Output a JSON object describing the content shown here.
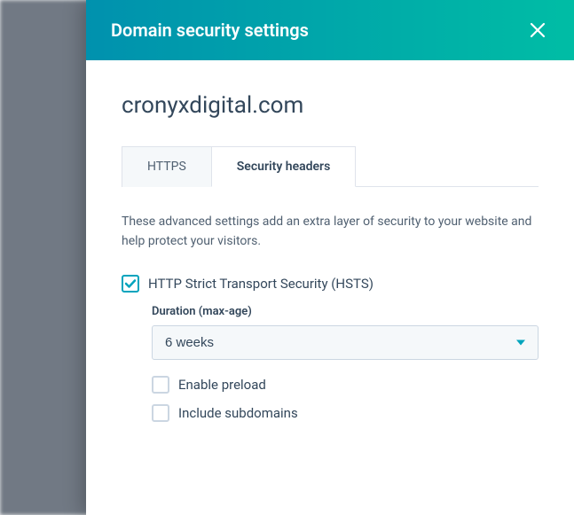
{
  "header": {
    "title": "Domain security settings"
  },
  "domain": "cronyxdigital.com",
  "tabs": {
    "https": "HTTPS",
    "security_headers": "Security headers"
  },
  "description": "These advanced settings add an extra layer of security to your website and help protect your visitors.",
  "hsts": {
    "label": "HTTP Strict Transport Security (HSTS)",
    "duration_label": "Duration (max-age)",
    "duration_value": "6 weeks",
    "enable_preload": "Enable preload",
    "include_subdomains": "Include subdomains"
  }
}
